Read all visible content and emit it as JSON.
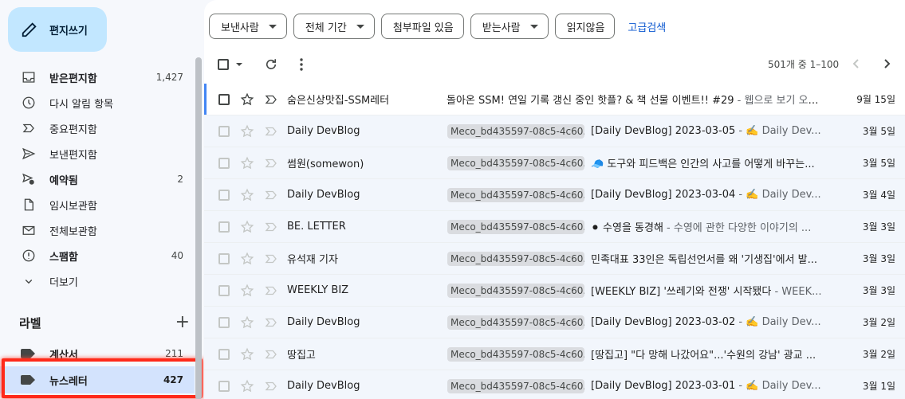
{
  "sidebar": {
    "compose_label": "편지쓰기",
    "items": [
      {
        "label": "받은편지함",
        "count": "1,427",
        "bold": true,
        "icon": "inbox-icon"
      },
      {
        "label": "다시 알림 항목",
        "count": "",
        "bold": false,
        "icon": "clock-icon"
      },
      {
        "label": "중요편지함",
        "count": "",
        "bold": false,
        "icon": "important-icon"
      },
      {
        "label": "보낸편지함",
        "count": "",
        "bold": false,
        "icon": "send-icon"
      },
      {
        "label": "예약됨",
        "count": "2",
        "bold": true,
        "icon": "scheduled-send-icon"
      },
      {
        "label": "임시보관함",
        "count": "",
        "bold": false,
        "icon": "draft-icon"
      },
      {
        "label": "전체보관함",
        "count": "",
        "bold": false,
        "icon": "all-mail-icon"
      },
      {
        "label": "스팸함",
        "count": "40",
        "bold": true,
        "icon": "spam-icon"
      },
      {
        "label": "더보기",
        "count": "",
        "bold": false,
        "icon": "chevron-down-icon"
      }
    ],
    "labels_title": "라벨",
    "labels_add": "+",
    "labels": [
      {
        "label": "계산서",
        "count": "211"
      },
      {
        "label": "뉴스레터",
        "count": "427"
      }
    ]
  },
  "filters": {
    "chips": [
      "보낸사람",
      "전체 기간",
      "첨부파일 있음",
      "받는사람",
      "읽지않음"
    ],
    "chips_with_caret": [
      true,
      true,
      false,
      true,
      false
    ],
    "advanced": "고급검색"
  },
  "toolbar": {
    "pager": "501개 중 1–100"
  },
  "emails": [
    {
      "sender": "숨은신상맛집-SSM레터",
      "label": "",
      "subject": "돌아온 SSM! 연일 기록 갱신 중인 핫플? & 책 선물 이벤트!! #29",
      "snippet": " - 웹으로 보기 오랜...",
      "date": "9월 15일",
      "unread": true
    },
    {
      "sender": "Daily DevBlog",
      "label": "Meco_bd435597-08c5-4c60...",
      "subject": "[Daily DevBlog] 2023-03-05",
      "snippet": " - ✍️ Daily Dev...",
      "date": "3월 5일",
      "unread": false
    },
    {
      "sender": "썸원(somewon)",
      "label": "Meco_bd435597-08c5-4c60...",
      "subject": "🧢 도구와 피드백은 인간의 사고를 어떻게 바꾸는...",
      "snippet": "",
      "date": "3월 5일",
      "unread": false
    },
    {
      "sender": "Daily DevBlog",
      "label": "Meco_bd435597-08c5-4c60...",
      "subject": "[Daily DevBlog] 2023-03-04",
      "snippet": " - ✍️ Daily Dev...",
      "date": "3월 4일",
      "unread": false
    },
    {
      "sender": "BE. LETTER",
      "label": "Meco_bd435597-08c5-4c60...",
      "subject": "⚫ 수영을 동경해",
      "snippet": " - 수영에 관한 다양한 이야기의 ...",
      "date": "3월 3일",
      "unread": false
    },
    {
      "sender": "유석재 기자",
      "label": "Meco_bd435597-08c5-4c60...",
      "subject": "민족대표 33인은 독립선언서를 왜 '기생집'에서 발...",
      "snippet": "",
      "date": "3월 3일",
      "unread": false
    },
    {
      "sender": "WEEKLY BIZ",
      "label": "Meco_bd435597-08c5-4c60...",
      "subject": "[WEEKLY BIZ] '쓰레기와 전쟁' 시작됐다",
      "snippet": " - WEEK...",
      "date": "3월 3일",
      "unread": false
    },
    {
      "sender": "Daily DevBlog",
      "label": "Meco_bd435597-08c5-4c60...",
      "subject": "[Daily DevBlog] 2023-03-02",
      "snippet": " - ✍️ Daily Dev...",
      "date": "3월 2일",
      "unread": false
    },
    {
      "sender": "땅집고",
      "label": "Meco_bd435597-08c5-4c60...",
      "subject": "[땅집고] \"다 망해 나갔어요\"...'수원의 강남' 광교 ...",
      "snippet": "",
      "date": "3월 2일",
      "unread": false
    },
    {
      "sender": "Daily DevBlog",
      "label": "Meco_bd435597-08c5-4c60...",
      "subject": "[Daily DevBlog] 2023-03-01",
      "snippet": " - ✍️ Daily Dev...",
      "date": "3월 1일",
      "unread": false
    }
  ],
  "colors": {
    "accent": "#0b57d0",
    "compose_bg": "#c2e7ff",
    "highlight": "#ff2a1a"
  }
}
